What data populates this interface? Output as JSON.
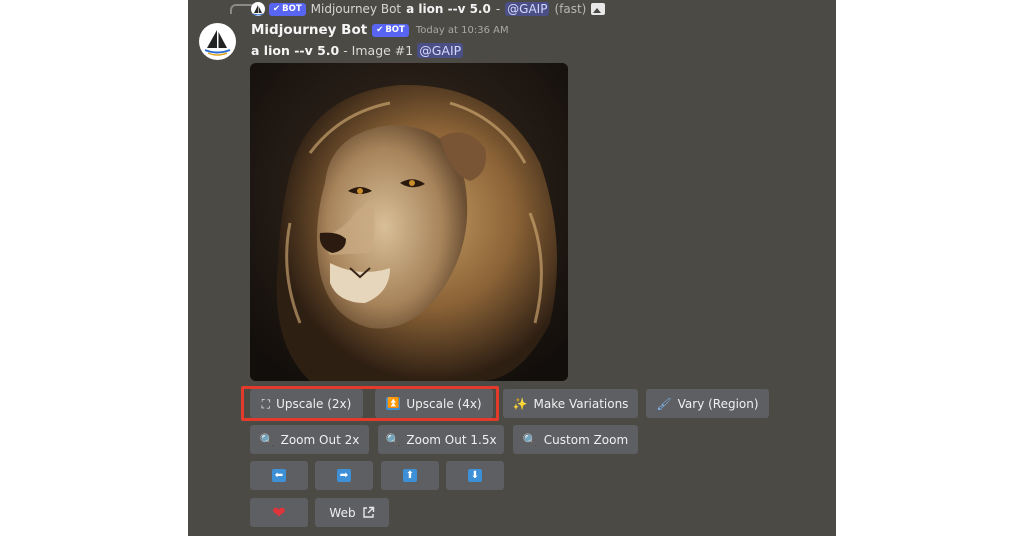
{
  "reply": {
    "author": "Midjourney Bot",
    "badge": "BOT",
    "prompt": "a lion --v 5.0",
    "separator": "-",
    "mention": "@GAIP",
    "mode": "(fast)"
  },
  "message": {
    "author": "Midjourney Bot",
    "badge": "BOT",
    "timestamp": "Today at 10:36 AM",
    "prompt": "a lion --v 5.0",
    "image_label": "- Image #1",
    "mention": "@GAIP"
  },
  "buttons": {
    "upscale_2x": "Upscale (2x)",
    "upscale_4x": "Upscale (4x)",
    "make_variations": "Make Variations",
    "vary_region": "Vary (Region)",
    "zoom_out_2x": "Zoom Out 2x",
    "zoom_out_1_5x": "Zoom Out 1.5x",
    "custom_zoom": "Custom Zoom",
    "web": "Web"
  },
  "colors": {
    "panel": "#4b4a45",
    "button": "#5e5f63",
    "highlight": "#e23b2b",
    "badge": "#5865f2"
  }
}
